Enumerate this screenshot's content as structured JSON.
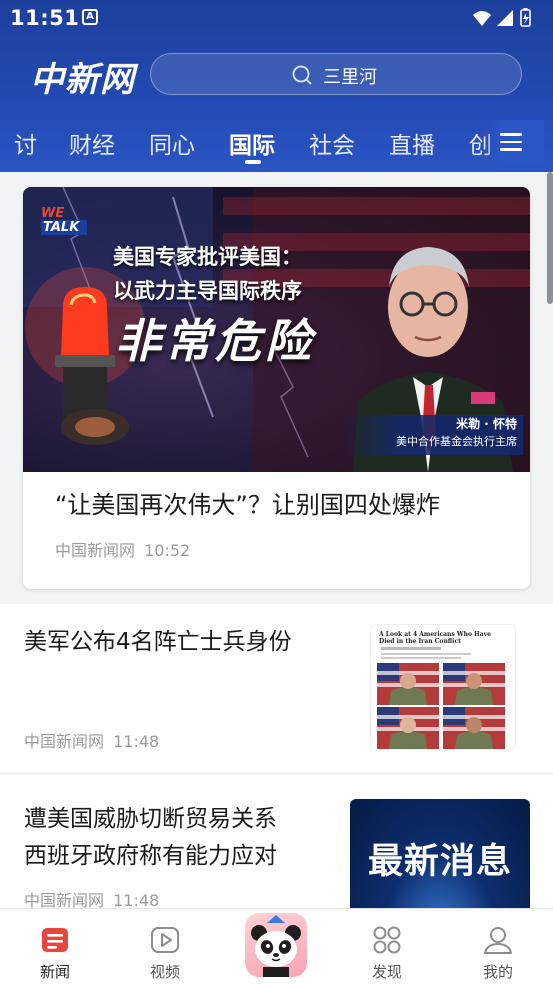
{
  "status_bar": {
    "time": "11:51",
    "app_icon_letter": "A"
  },
  "header": {
    "logo": "中新网",
    "search": {
      "placeholder": "三里河"
    },
    "tabs": [
      {
        "label": "讨"
      },
      {
        "label": "财经"
      },
      {
        "label": "同心"
      },
      {
        "label": "国际",
        "active": true
      },
      {
        "label": "社会"
      },
      {
        "label": "直播"
      },
      {
        "label": "创"
      }
    ]
  },
  "feed": {
    "hero": {
      "badge_top": "WE",
      "badge_bottom": "TALK",
      "overlay_line1": "美国专家批评美国：",
      "overlay_line2": "以武力主导国际秩序",
      "overlay_big": "非常危险",
      "caption_name": "米勒 · 怀特",
      "caption_role": "美中合作基金会执行主席",
      "title": "“让美国再次伟大”？让别国四处爆炸",
      "source": "中国新闻网",
      "time": "10:52"
    },
    "items": [
      {
        "title": "美军公布4名阵亡士兵身份",
        "source": "中国新闻网",
        "time": "11:48",
        "thumb_heading": "A Look at 4 Americans Who Have Died in the Iran Conflict"
      },
      {
        "title_line1": "遭美国威胁切断贸易关系",
        "title_line2": "西班牙政府称有能力应对",
        "source": "中国新闻网",
        "time": "11:48",
        "thumb_text": "最新消息"
      }
    ]
  },
  "bottom_nav": [
    {
      "label": "新闻",
      "icon": "news-icon",
      "active": true
    },
    {
      "label": "视频",
      "icon": "video-icon"
    },
    {
      "label": "",
      "icon": "panda-icon"
    },
    {
      "label": "发现",
      "icon": "discover-icon"
    },
    {
      "label": "我的",
      "icon": "profile-icon"
    }
  ],
  "colors": {
    "header_blue": "#244ab3",
    "accent_red": "#e8453c"
  }
}
